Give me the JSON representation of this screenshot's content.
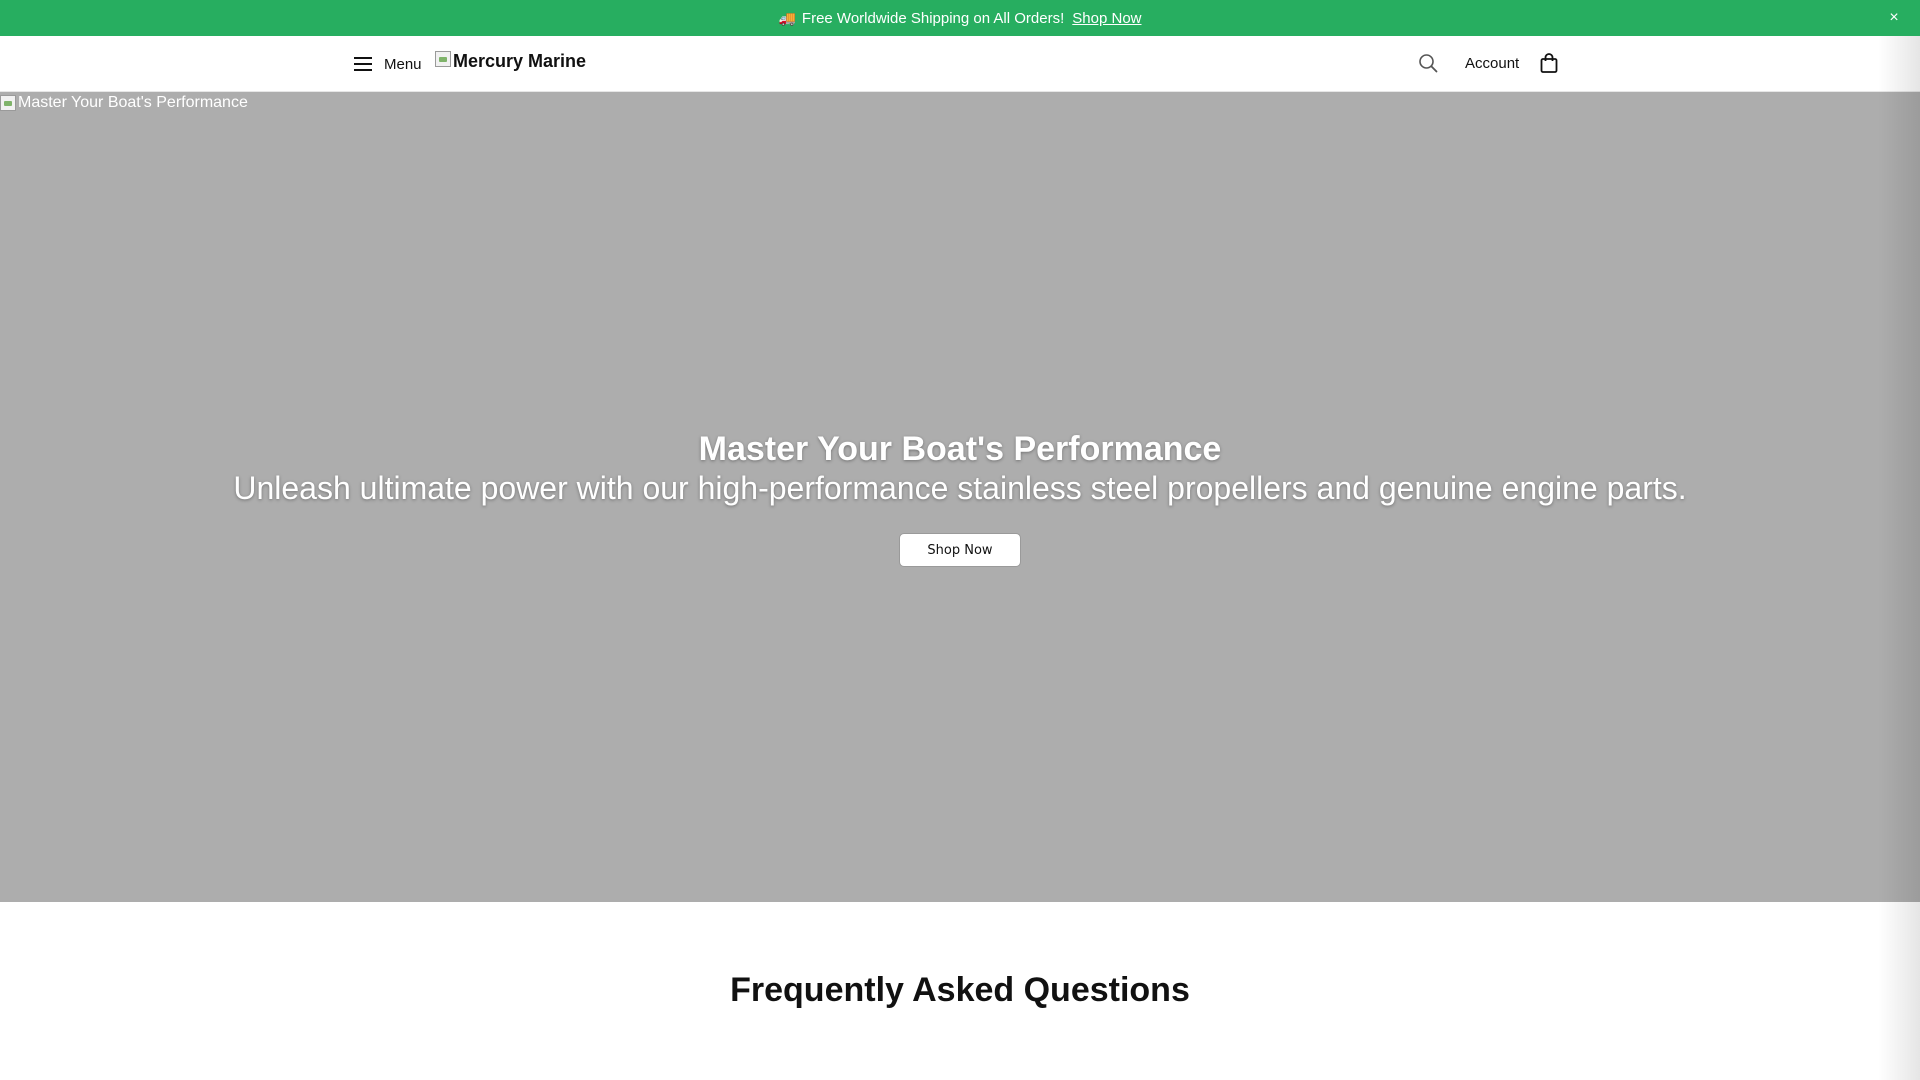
{
  "announcement": {
    "text": "Free Worldwide Shipping on All Orders!",
    "link_label": "Shop Now",
    "icon": "truck-icon",
    "close_label": "×",
    "background_color": "#27ae60"
  },
  "header": {
    "menu_label": "Menu",
    "logo_text": "Mercury Marine",
    "account_label": "Account",
    "icons": [
      "hamburger-icon",
      "search-icon",
      "shopping-bag-icon"
    ]
  },
  "hero": {
    "image_alt": "Master Your Boat's Performance",
    "title": "Master Your Boat's Performance",
    "subtitle": "Unleash ultimate power with our high-performance stainless steel propellers and genuine engine parts.",
    "button_label": "Shop Now",
    "background_color": "#adadad"
  },
  "faq": {
    "title": "Frequently Asked Questions"
  }
}
